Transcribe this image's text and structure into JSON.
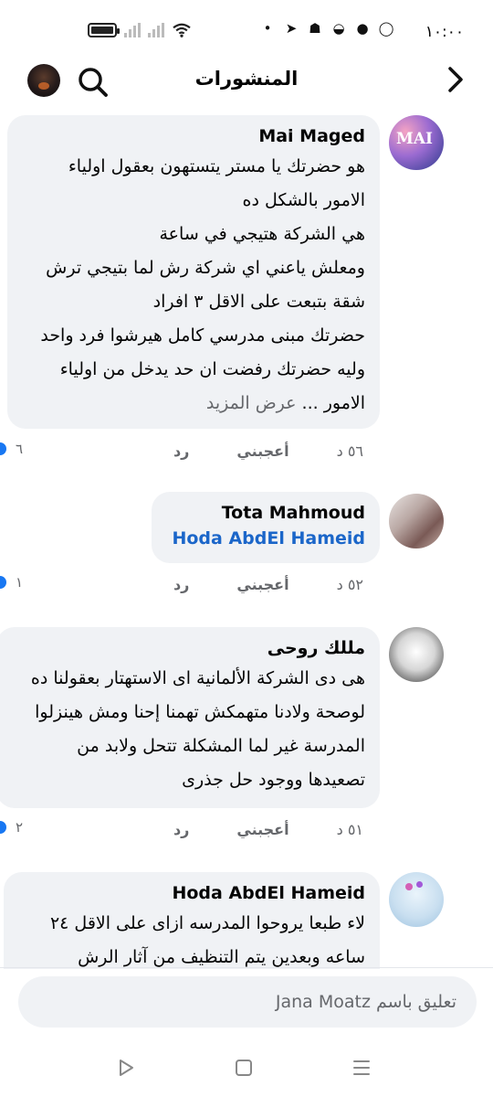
{
  "status_bar": {
    "time": "١٠:٠٠",
    "notification_icons": [
      "whatsapp-icon",
      "chat-bubble-icon",
      "messenger-icon",
      "snapchat-icon",
      "telegram-icon",
      "dot-icon"
    ]
  },
  "header": {
    "title": "المنشورات",
    "back_icon": "chevron-right-icon",
    "search_icon": "search-icon"
  },
  "comments": [
    {
      "author": "Mai Maged",
      "lines": [
        "هو حضرتك يا مستر يتستهون بعقول اولياء",
        "الامور بالشكل ده",
        "هي الشركة هتيجي في ساعة",
        "ومعلش ياعني اي شركة رش لما بتيجي ترش",
        "شقة بتبعت على الاقل ٣ افراد",
        "حضرتك مبنى مدرسي كامل هيرشوا فرد واحد",
        "وليه حضرتك رفضت ان حد يدخل من اولياء"
      ],
      "last_line": "الامور ...",
      "see_more": "عرض المزيد",
      "time": "٥٦ د",
      "like": "أعجبني",
      "reply": "رد",
      "reactions": "٦"
    },
    {
      "author": "Tota Mahmoud",
      "mention": "Hoda AbdEl Hameid",
      "time": "٥٢ د",
      "like": "أعجبني",
      "reply": "رد",
      "reactions": "١"
    },
    {
      "author": "مللك روحى",
      "lines": [
        "هى دى الشركة الألمانية اى الاستهتار بعقولنا ده",
        "لوصحة ولادنا متهمكش تهمنا إحنا ومش هينزلوا",
        "المدرسة غير لما المشكلة تتحل ولابد من",
        "تصعيدها ووجود حل جذرى"
      ],
      "time": "٥١ د",
      "like": "أعجبني",
      "reply": "رد",
      "reactions": "٢"
    },
    {
      "author": "Hoda AbdEl Hameid",
      "lines": [
        "لاء طبعا يروحوا المدرسه ازاى على الاقل ٢٤",
        "ساعه وبعدين يتم التنظيف من آثار الرش"
      ]
    }
  ],
  "composer": {
    "placeholder": "تعليق باسم Jana Moatz"
  },
  "navbar": {
    "icons": [
      "back-triangle-icon",
      "home-square-icon",
      "menu-lines-icon"
    ]
  }
}
